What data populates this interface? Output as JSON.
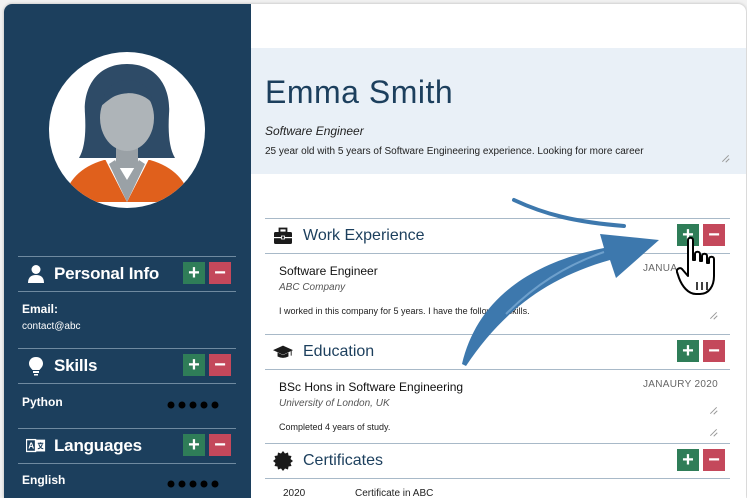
{
  "profile": {
    "name": "Emma Smith",
    "title": "Software Engineer",
    "summary": "25 year old with 5 years of Software Engineering experience. Looking for more career"
  },
  "sidebar": {
    "personal_info": {
      "label": "Personal Info",
      "email_label": "Email:",
      "email_value": "contact@abc"
    },
    "skills": {
      "label": "Skills",
      "items": [
        {
          "name": "Python",
          "rating": 5
        }
      ]
    },
    "languages": {
      "label": "Languages",
      "items": [
        {
          "name": "English",
          "rating": 5
        }
      ]
    }
  },
  "sections": {
    "work": {
      "label": "Work Experience",
      "entry": {
        "title": "Software Engineer",
        "company": "ABC Company",
        "date": "JANUA",
        "description": "I worked in this company for 5 years. I have the following skills."
      }
    },
    "education": {
      "label": "Education",
      "entry": {
        "title": "BSc Hons in Software Engineering",
        "institution": "University of London, UK",
        "date": "JANAURY 2020",
        "description": "Completed 4 years of study."
      }
    },
    "certificates": {
      "label": "Certificates",
      "entry": {
        "year": "2020",
        "name": "Certificate in ABC"
      }
    }
  },
  "controls": {
    "plus": "+",
    "minus": "−"
  },
  "colors": {
    "sidebar": "#1c3f5d",
    "hero": "#e9f0f7",
    "add": "#2f7d58",
    "remove": "#c4485b",
    "arrow": "#3d78ad",
    "avatar_shirt": "#e0601c"
  },
  "icons": {
    "personal": "person-icon",
    "skills": "lightbulb-icon",
    "languages": "translate-icon",
    "work": "briefcase-icon",
    "education": "graduation-cap-icon",
    "certificates": "badge-icon",
    "cursor": "hand-pointer-icon"
  }
}
